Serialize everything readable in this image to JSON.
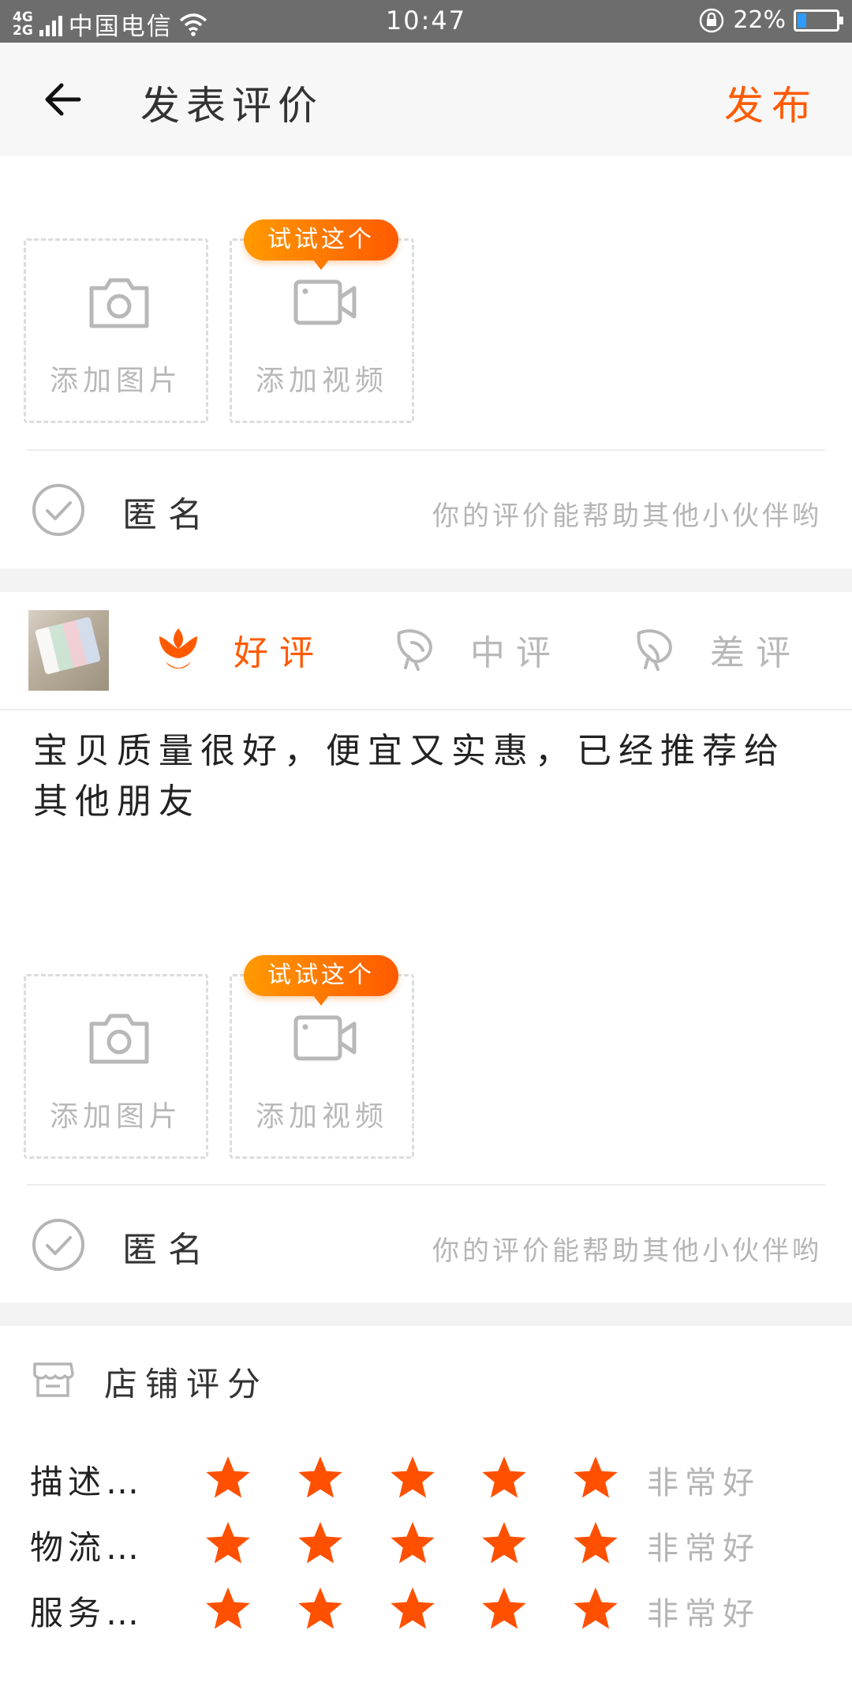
{
  "status_bar": {
    "network": "4G",
    "network2": "2G",
    "carrier": "中国电信",
    "time": "10:47",
    "battery_percent": "22%",
    "battery_level": 0.22,
    "colors": {
      "background": "#6d6d6d",
      "battery": "#2f9bff"
    }
  },
  "header": {
    "title": "发表评价",
    "publish_label": "发布",
    "back_icon": "arrow-left-icon",
    "accent_color": "#ff5a00"
  },
  "media_section_1": {
    "add_photo_label": "添加图片",
    "add_video_label": "添加视频",
    "try_badge": "试试这个",
    "photo_icon": "camera-icon",
    "video_icon": "video-camera-icon"
  },
  "anonymous_1": {
    "label": "匿名",
    "hint": "你的评价能帮助其他小伙伴哟",
    "checked_icon": "check-circle-icon"
  },
  "rating": {
    "options": [
      {
        "label": "好评",
        "icon": "flower-good-icon",
        "selected": true
      },
      {
        "label": "中评",
        "icon": "flower-neutral-icon",
        "selected": false
      },
      {
        "label": "差评",
        "icon": "flower-bad-icon",
        "selected": false
      }
    ],
    "selected_color": "#ff5a00",
    "unselected_color": "#b8b8b8"
  },
  "comment": {
    "text": "宝贝质量很好，便宜又实惠，已经推荐给其他朋友"
  },
  "media_section_2": {
    "add_photo_label": "添加图片",
    "add_video_label": "添加视频",
    "try_badge": "试试这个"
  },
  "anonymous_2": {
    "label": "匿名",
    "hint": "你的评价能帮助其他小伙伴哟"
  },
  "shop_rating": {
    "title": "店铺评分",
    "icon": "store-icon",
    "star_color": "#ff5000",
    "rows": [
      {
        "label": "描述…",
        "stars": 5,
        "max_stars": 5,
        "text": "非常好"
      },
      {
        "label": "物流…",
        "stars": 5,
        "max_stars": 5,
        "text": "非常好"
      },
      {
        "label": "服务…",
        "stars": 5,
        "max_stars": 5,
        "text": "非常好"
      }
    ]
  }
}
